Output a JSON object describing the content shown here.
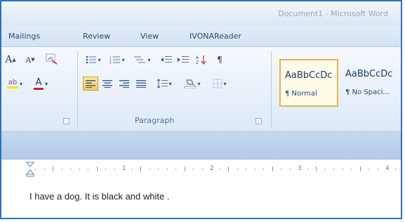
{
  "window": {
    "title": "Document1 - Microsoft Word"
  },
  "tabs": [
    {
      "label": "Mailings"
    },
    {
      "label": "Review"
    },
    {
      "label": "View"
    },
    {
      "label": "IVONAReader"
    }
  ],
  "ribbon": {
    "font_group": {
      "grow_font": "A",
      "shrink_font": "A",
      "highlight_icon": "highlighter-icon",
      "font_color_letter": "A",
      "font_color_hex": "#d22222",
      "highlight_color_hex": "#ffe000"
    },
    "paragraph_group": {
      "label": "Paragraph",
      "align_left_selected": true
    },
    "styles": [
      {
        "preview": "AaBbCcDc",
        "name": "¶ Normal"
      },
      {
        "preview": "AaBbCcDc",
        "name": "¶ No Spaci..."
      }
    ]
  },
  "ruler": {
    "numbers": [
      "1",
      "2",
      "3",
      "4"
    ]
  },
  "document": {
    "text": "I have a dog. It is black and white ."
  },
  "colors": {
    "frame_border": "#2b6fc4",
    "selected_button": "#f7c85a"
  }
}
